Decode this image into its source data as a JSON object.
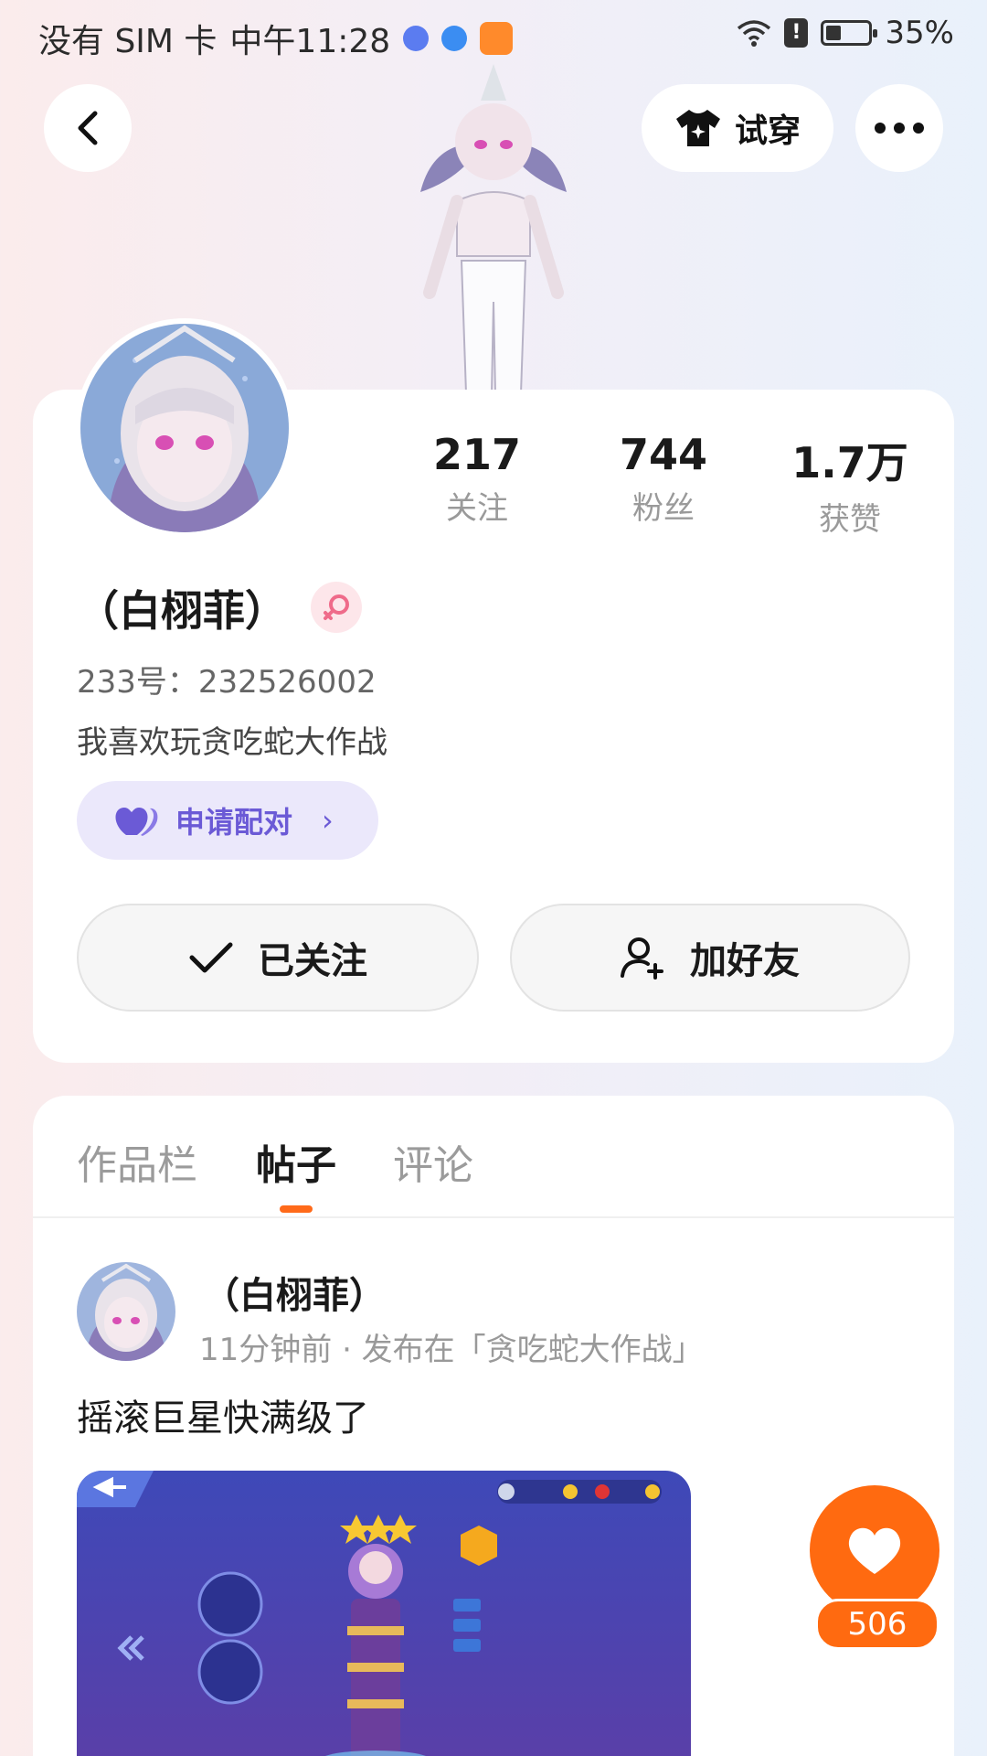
{
  "status_bar": {
    "carrier": "没有 SIM 卡",
    "time": "中午11:28",
    "battery": "35%",
    "battery_level": 0.35
  },
  "header": {
    "try_on_label": "试穿"
  },
  "profile": {
    "stats": [
      {
        "value": "217",
        "label": "关注"
      },
      {
        "value": "744",
        "label": "粉丝"
      },
      {
        "value": "1.7万",
        "label": "获赞"
      }
    ],
    "name": "（白栩菲）",
    "uid": "233号：232526002",
    "bio": "我喜欢玩贪吃蛇大作战",
    "pair_label": "申请配对",
    "follow_label": "已关注",
    "add_friend_label": "加好友"
  },
  "tabs": [
    {
      "label": "作品栏",
      "active": false
    },
    {
      "label": "帖子",
      "active": true
    },
    {
      "label": "评论",
      "active": false
    }
  ],
  "post": {
    "author": "（白栩菲）",
    "meta": "11分钟前 · 发布在「贪吃蛇大作战」",
    "text": "摇滚巨星快满级了",
    "likes": "506"
  },
  "colors": {
    "accent": "#ff6a10",
    "pair": "#6b5ad6"
  }
}
